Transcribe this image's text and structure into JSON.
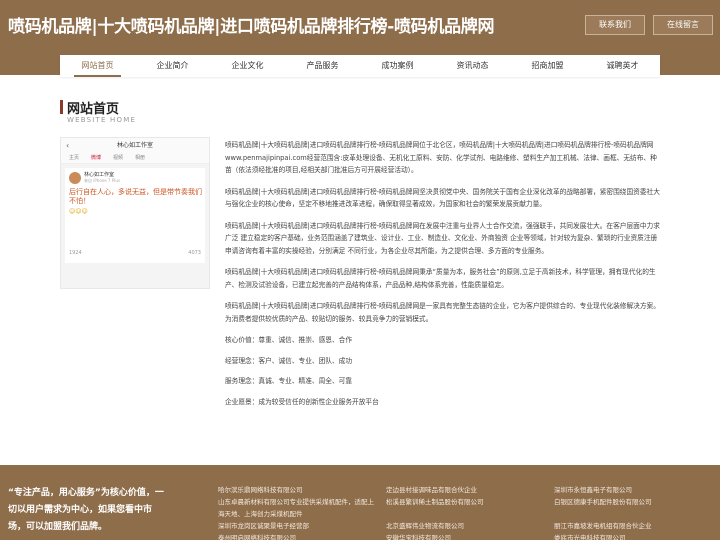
{
  "header": {
    "site_title": "喷码机品牌|十大喷码机品牌|进口喷码机品牌排行榜-喷码机品牌网",
    "contact_label": "联系我们",
    "message_label": "在线留言"
  },
  "nav": {
    "items": [
      {
        "label": "网站首页"
      },
      {
        "label": "企业简介"
      },
      {
        "label": "企业文化"
      },
      {
        "label": "产品服务"
      },
      {
        "label": "成功案例"
      },
      {
        "label": "资讯动态"
      },
      {
        "label": "招商加盟"
      },
      {
        "label": "诚聘英才"
      }
    ]
  },
  "section": {
    "title": "网站首页",
    "subtitle": "WEBSITE HOME"
  },
  "phone": {
    "back": "‹",
    "title": "林心如工作室",
    "tab1": "主页",
    "tab2": "微博",
    "tab3": "视频",
    "tab4": "相册",
    "name": "林心如工作室",
    "meta": "来自 iPhone 7 Plus",
    "text": "后行自在人心，多说无益，但是带节奏我们不怕！",
    "emoji": "☺☺☺",
    "stat1": "1924",
    "stat2": "4073"
  },
  "content": {
    "paragraphs": [
      "喷码机品牌|十大喷码机品牌|进口喷码机品牌排行榜-喷码机品牌网位于北仑区，喷码机品牌|十大喷码机品牌|进口喷码机品牌排行榜-喷码机品牌网www.penmajipinpai.com经营范围含:皮革处理设备、无机化工原料、安防、化学试剂、电路维修、塑料生产加工机械、法律、画框、无纺布、种苗（依法须经批准的项目,经相关部门批准后方可开展经营活动）。",
      "喷码机品牌|十大喷码机品牌|进口喷码机品牌排行榜-喷码机品牌网坚决贯彻党中央、国务院关于国有企业深化改革的战略部署，紧密围绕国资委社大与强化企业的核心使命，坚定不移地推进改革进程，确保取得显著成效，为国家和社会的繁荣发展贡献力量。",
      "喷码机品牌|十大喷码机品牌|进口喷码机品牌排行榜-喷码机品牌网在发展中注重与业界人士合作交流，强强联手，共同发展壮大。在客户层面中力求广泛 建立稳定的客户基础，业务范围涵盖了建筑业、设计业、工业、制造业、文化业、外商独资 企业等领域，针对较为复杂、繁琐的行业资质注册申请咨询有着丰富的实操经验，分别满足 不同行业，为各企业尽其所能，为之提供合理、多方面的专业服务。",
      "喷码机品牌|十大喷码机品牌|进口喷码机品牌排行榜-喷码机品牌网秉承“质量为本，服务社会”的原则,立足于高新技术，科学管理，拥有现代化的生产、检测及试验设备，已建立起完善的产品结构体系，产品品种,结构体系完善，性能质量稳定。",
      "喷码机品牌|十大喷码机品牌|进口喷码机品牌排行榜-喷码机品牌网是一家具有完整生态链的企业，它为客户提供综合的、专业现代化装修解决方案。为消费者提供较优质的产品、较贴切的服务、较具竞争力的营销模式。"
    ],
    "values_line": "核心价值：尊重、诚信、推崇、感恩、合作",
    "philosophy_line": "经营理念：客户、诚信、专业、团队、成功",
    "service_line": "服务理念：真诚、专业、精准、周全、可靠",
    "vision_line": "企业愿景：成为较受信任的创新性企业服务开放平台"
  },
  "footer": {
    "slogan": "“专注产品，用心服务”为核心价值，一切以用户需求为中心，如果您看中市场，可以加盟我们品牌。",
    "col1": [
      "哈尔滨乐鼎网络科技有限公司",
      "山东卓晨新材料有限公司专业提供采煤机配件，适配上海天地、上海创力采煤机配件",
      "深圳市龙岗区诚聚景电子经营部",
      "泰州明启网络科技有限公司"
    ],
    "col2": [
      "定边县村接调味品有限合伙企业",
      "松溪县繁训稀土制品股份有限公司",
      "北京盛辉伟业物流有限公司",
      "安徽华宝科技有限公司"
    ],
    "col3": [
      "深圳市永恒鑫电子有限公司",
      "白银区德康手机配件股份有限公司",
      "丽江市嘉坡发电机组有限合伙企业",
      "娄底市光电科技有限公司"
    ]
  }
}
